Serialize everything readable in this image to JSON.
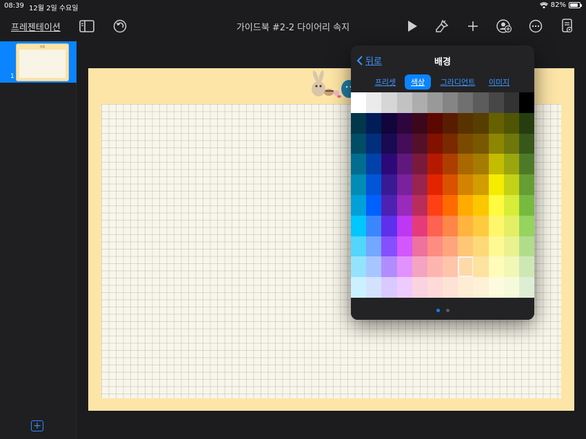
{
  "status": {
    "time": "08:39",
    "date": "12월 2일 수요일",
    "battery": "82%",
    "battery_level": 0.82
  },
  "toolbar": {
    "present_label": "프레젠테이션",
    "doc_title": "가이드북 #2-2 다이어리 속지"
  },
  "navigator": {
    "slide_number": "1",
    "thumb_caption": "다음"
  },
  "popover": {
    "back_label": "뒤로",
    "title": "배경",
    "tabs": [
      {
        "label": "프리셋",
        "active": false
      },
      {
        "label": "색상",
        "active": true
      },
      {
        "label": "그라디언트",
        "active": false
      },
      {
        "label": "이미지",
        "active": false
      }
    ],
    "page_indicator": {
      "count": 2,
      "current": 0
    },
    "selected_swatch": {
      "row": 8,
      "col": 7,
      "color": "#fde2a0"
    },
    "palette": [
      [
        "#ffffff",
        "#ebebeb",
        "#d6d6d6",
        "#c2c2c2",
        "#adadad",
        "#999999",
        "#858585",
        "#707070",
        "#5c5c5c",
        "#474747",
        "#333333",
        "#000000"
      ],
      [
        "#00374a",
        "#011d57",
        "#11053b",
        "#2e063d",
        "#3c071b",
        "#5c0701",
        "#5a1c00",
        "#583300",
        "#563d00",
        "#666100",
        "#4f5504",
        "#263e0f"
      ],
      [
        "#004d65",
        "#012f7b",
        "#1a0a52",
        "#450d59",
        "#551029",
        "#831100",
        "#7b2900",
        "#7a4a00",
        "#785800",
        "#8c8602",
        "#6f760a",
        "#38571a"
      ],
      [
        "#016e8f",
        "#0042a9",
        "#2c0977",
        "#61187c",
        "#791a3d",
        "#b51a00",
        "#ad3e00",
        "#a96800",
        "#a67b01",
        "#c4bc00",
        "#9ba50e",
        "#4e7a27"
      ],
      [
        "#008cb4",
        "#0056d6",
        "#371a94",
        "#7a219e",
        "#99244f",
        "#e22400",
        "#da5100",
        "#d38301",
        "#d19d01",
        "#f5ec00",
        "#c3d117",
        "#669d34"
      ],
      [
        "#00a1d8",
        "#0061fd",
        "#4d22b2",
        "#982abc",
        "#b92d5d",
        "#ff4015",
        "#ff6a00",
        "#ffab01",
        "#fcc700",
        "#fefb41",
        "#d9ec37",
        "#76bb40"
      ],
      [
        "#01c7fc",
        "#3a87fd",
        "#5e30eb",
        "#be38f3",
        "#e63b7a",
        "#fe6250",
        "#fe8648",
        "#feb43f",
        "#fecb3e",
        "#fff76b",
        "#e4ef65",
        "#96d35f"
      ],
      [
        "#52d6fc",
        "#74a7ff",
        "#864ffd",
        "#d357fe",
        "#ee719e",
        "#ff8c82",
        "#fea57d",
        "#fec777",
        "#fed977",
        "#fff994",
        "#eaf28f",
        "#b1dd8b"
      ],
      [
        "#93e3fc",
        "#a7c6ff",
        "#b18cfe",
        "#e292fe",
        "#f4a4c0",
        "#ffb5af",
        "#ffc5ab",
        "#fed9a8",
        "#fde2a0",
        "#fffbb9",
        "#f1f7b7",
        "#cde8b5"
      ],
      [
        "#cbf0ff",
        "#d3e2ff",
        "#d9c9fe",
        "#efcaff",
        "#f9d3e0",
        "#ffdad8",
        "#ffe2d6",
        "#feecd4",
        "#fef1d5",
        "#fdfbdd",
        "#f6fadb",
        "#deeed4"
      ]
    ]
  }
}
